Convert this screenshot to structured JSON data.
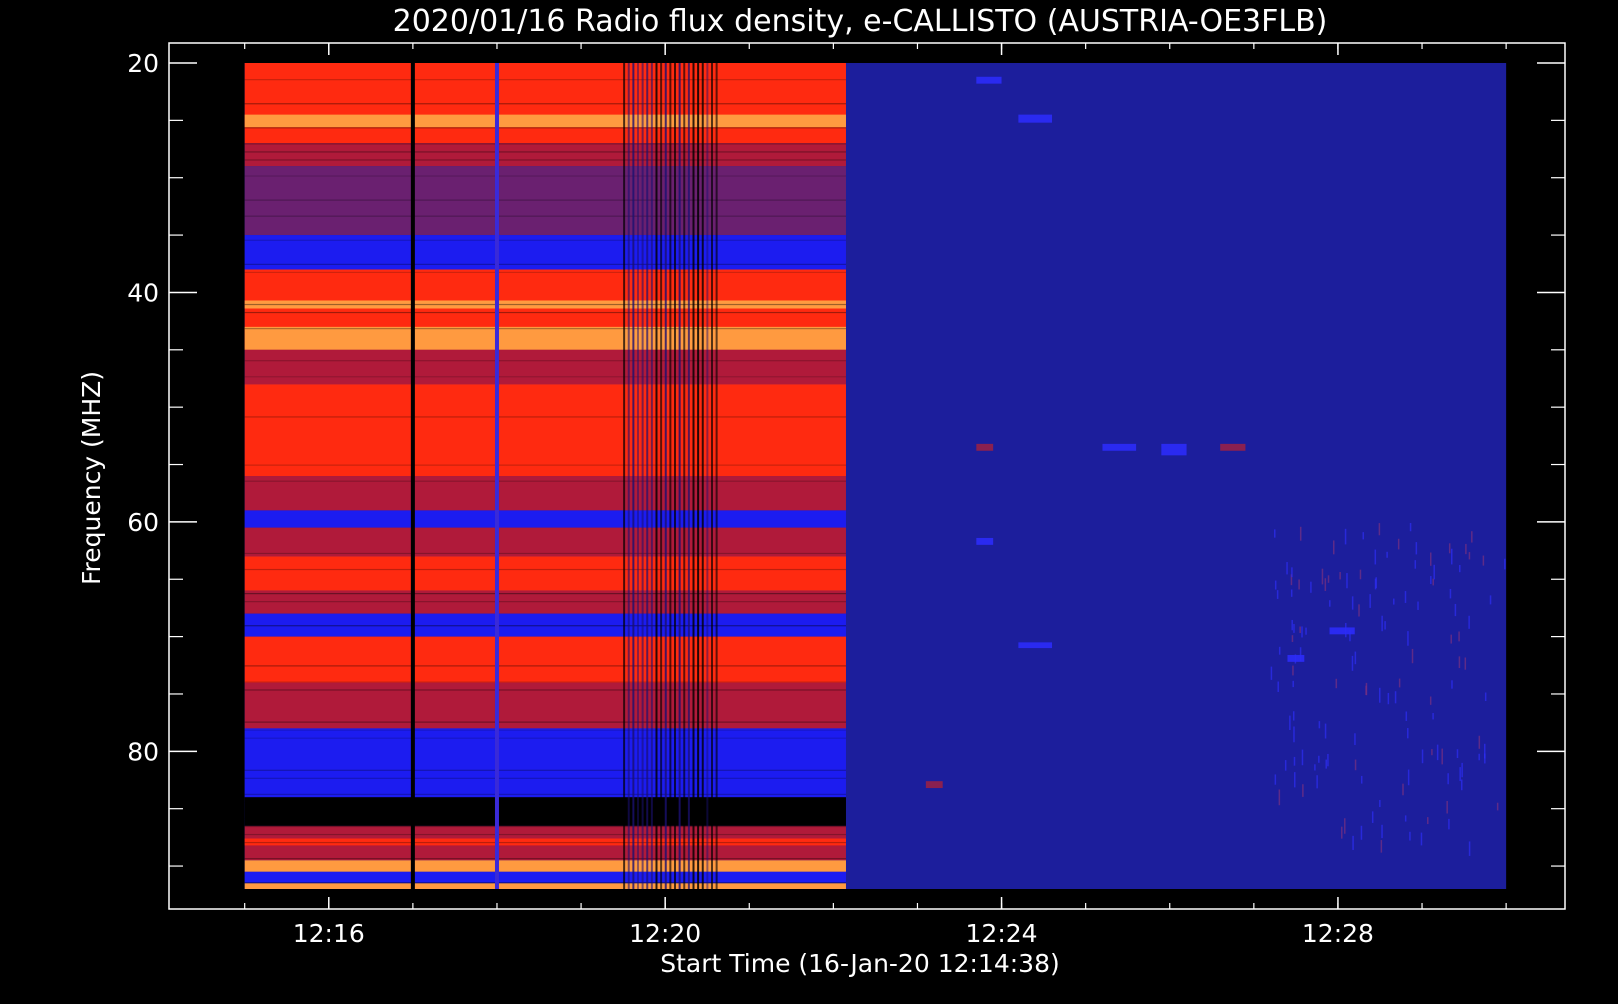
{
  "chart_data": {
    "type": "heatmap",
    "title": "2020/01/16  Radio flux density, e-CALLISTO (AUSTRIA-OE3FLB)",
    "xlabel": "Start Time (16-Jan-20 12:14:38)",
    "ylabel": "Frequency (MHZ)",
    "x_unit": "minutes",
    "xlim": [
      14.1,
      30.7
    ],
    "ylim": [
      20,
      92
    ],
    "y_inverted": true,
    "data_x_range": [
      15.0,
      30.0
    ],
    "x_ticks": [
      {
        "value": 16,
        "label": "12:16"
      },
      {
        "value": 20,
        "label": "12:20"
      },
      {
        "value": 24,
        "label": "12:24"
      },
      {
        "value": 28,
        "label": "12:28"
      }
    ],
    "y_ticks": [
      {
        "value": 20,
        "label": "20"
      },
      {
        "value": 40,
        "label": "40"
      },
      {
        "value": 60,
        "label": "60"
      },
      {
        "value": 80,
        "label": "80"
      }
    ],
    "colors": {
      "background": "#000000",
      "axis": "#ffffff",
      "quiet_background": "#1c1e9c",
      "strong": "#ff2a10",
      "medium": "#b01a3a",
      "weak": "#1c1cf0",
      "peak": "#ff9a40",
      "gap": "#000000"
    },
    "active_interval": {
      "start": 15.0,
      "end": 22.15
    },
    "frequency_bands": [
      {
        "f0": 20,
        "f1": 27,
        "level": "strong"
      },
      {
        "f0": 24.5,
        "f1": 25.6,
        "level": "peak"
      },
      {
        "f0": 27,
        "f1": 29,
        "level": "medium"
      },
      {
        "f0": 29,
        "f1": 35,
        "level": "medium-weak"
      },
      {
        "f0": 35,
        "f1": 38,
        "level": "weak"
      },
      {
        "f0": 38,
        "f1": 45,
        "level": "strong"
      },
      {
        "f0": 40.7,
        "f1": 41.4,
        "level": "peak"
      },
      {
        "f0": 43,
        "f1": 45,
        "level": "peak"
      },
      {
        "f0": 45,
        "f1": 48,
        "level": "medium"
      },
      {
        "f0": 48,
        "f1": 56,
        "level": "strong"
      },
      {
        "f0": 56,
        "f1": 59,
        "level": "medium"
      },
      {
        "f0": 59,
        "f1": 60.5,
        "level": "weak"
      },
      {
        "f0": 60.5,
        "f1": 63,
        "level": "medium"
      },
      {
        "f0": 63,
        "f1": 66,
        "level": "strong"
      },
      {
        "f0": 66,
        "f1": 68,
        "level": "medium"
      },
      {
        "f0": 68,
        "f1": 70,
        "level": "weak"
      },
      {
        "f0": 70,
        "f1": 74,
        "level": "strong"
      },
      {
        "f0": 74,
        "f1": 78,
        "level": "medium"
      },
      {
        "f0": 78,
        "f1": 84,
        "level": "weak"
      },
      {
        "f0": 84,
        "f1": 86.5,
        "level": "gap"
      },
      {
        "f0": 86.5,
        "f1": 89.5,
        "level": "medium"
      },
      {
        "f0": 87.6,
        "f1": 88.2,
        "level": "strong"
      },
      {
        "f0": 89.5,
        "f1": 90.5,
        "level": "peak"
      },
      {
        "f0": 90.5,
        "f1": 91.5,
        "level": "weak"
      },
      {
        "f0": 91.5,
        "f1": 92,
        "level": "peak"
      }
    ],
    "time_dropouts": [
      {
        "t": 17.0,
        "style": "gap"
      },
      {
        "t": 18.0,
        "style": "weak"
      }
    ],
    "interference_region": {
      "start": 19.5,
      "end": 20.6
    },
    "quiet_spots": [
      {
        "t0": 23.7,
        "t1": 24.0,
        "f0": 21.2,
        "f1": 21.8
      },
      {
        "t0": 24.2,
        "t1": 24.6,
        "f0": 24.5,
        "f1": 25.2
      },
      {
        "t0": 23.7,
        "t1": 23.9,
        "f0": 53.2,
        "f1": 53.8
      },
      {
        "t0": 25.2,
        "t1": 25.6,
        "f0": 53.2,
        "f1": 53.8
      },
      {
        "t0": 25.9,
        "t1": 26.2,
        "f0": 53.2,
        "f1": 54.2
      },
      {
        "t0": 26.6,
        "t1": 26.9,
        "f0": 53.2,
        "f1": 53.8
      },
      {
        "t0": 23.7,
        "t1": 23.9,
        "f0": 61.4,
        "f1": 62.0
      },
      {
        "t0": 24.2,
        "t1": 24.6,
        "f0": 70.5,
        "f1": 71.0
      },
      {
        "t0": 23.1,
        "t1": 23.3,
        "f0": 82.6,
        "f1": 83.2
      },
      {
        "t0": 27.4,
        "t1": 27.6,
        "f0": 71.6,
        "f1": 72.2
      },
      {
        "t0": 27.9,
        "t1": 28.2,
        "f0": 69.2,
        "f1": 69.8
      }
    ]
  }
}
